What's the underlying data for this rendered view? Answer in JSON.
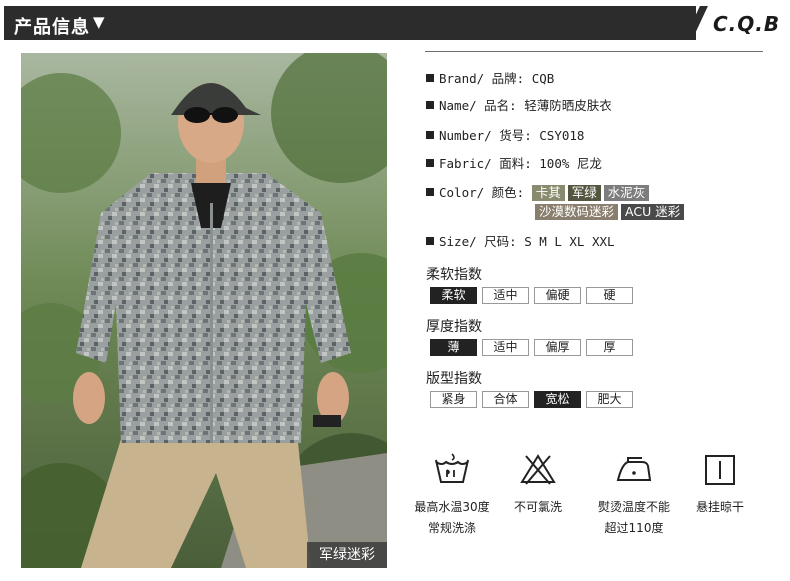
{
  "header": {
    "title": "产品信息",
    "caret": "▼",
    "logo": "C.Q.B"
  },
  "photo": {
    "caption": "军绿迷彩"
  },
  "specs": {
    "brand": {
      "label": "Brand/ 品牌:",
      "value": "CQB"
    },
    "name": {
      "label": "Name/ 品名:",
      "value": "轻薄防晒皮肤衣"
    },
    "number": {
      "label": "Number/ 货号:",
      "value": "CSY018"
    },
    "fabric": {
      "label": "Fabric/ 面料:",
      "value": "100% 尼龙"
    },
    "color": {
      "label": "Color/ 颜色:",
      "options": [
        {
          "text": "卡其",
          "bg": "#8a8a6e"
        },
        {
          "text": "军绿",
          "bg": "#55563f"
        },
        {
          "text": "水泥灰",
          "bg": "#7d7d7d"
        },
        {
          "text": "沙漠数码迷彩",
          "bg": "#8a7f6e"
        },
        {
          "text": "ACU 迷彩",
          "bg": "#4a4a4a"
        }
      ]
    },
    "size": {
      "label": "Size/ 尺码:",
      "value": "S M L XL XXL"
    }
  },
  "indices": [
    {
      "title": "柔软指数",
      "options": [
        "柔软",
        "适中",
        "偏硬",
        "硬"
      ],
      "selected": 0
    },
    {
      "title": "厚度指数",
      "options": [
        "薄",
        "适中",
        "偏厚",
        "厚"
      ],
      "selected": 0
    },
    {
      "title": "版型指数",
      "options": [
        "紧身",
        "合体",
        "宽松",
        "肥大"
      ],
      "selected": 2
    }
  ],
  "care": [
    {
      "icon": "wash-30-icon",
      "line1": "最高水温30度",
      "line2": "常规洗涤"
    },
    {
      "icon": "no-bleach-icon",
      "line1": "不可氯洗",
      "line2": ""
    },
    {
      "icon": "iron-icon",
      "line1": "熨烫温度不能",
      "line2": "超过110度"
    },
    {
      "icon": "hang-dry-icon",
      "line1": "悬挂晾干",
      "line2": ""
    }
  ]
}
